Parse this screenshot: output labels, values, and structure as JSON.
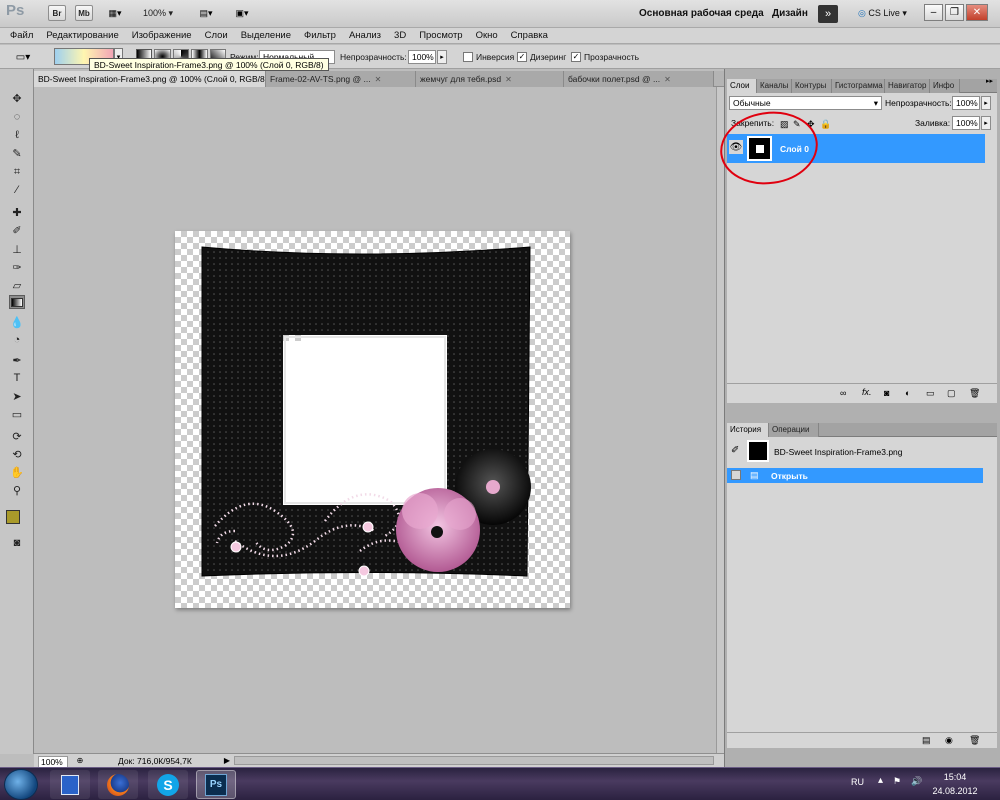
{
  "appbar": {
    "app_logo": "Ps",
    "br_label": "Br",
    "mb_label": "Mb",
    "zoom": "100%",
    "workspace": "Основная рабочая среда",
    "design": "Дизайн",
    "more": "»",
    "cslive": "CS Live",
    "cslive_arrow": "▾"
  },
  "window_controls": {
    "minimize": "–",
    "restore": "❐",
    "close": "✕"
  },
  "menu": [
    "Файл",
    "Редактирование",
    "Изображение",
    "Слои",
    "Выделение",
    "Фильтр",
    "Анализ",
    "3D",
    "Просмотр",
    "Окно",
    "Справка"
  ],
  "options": {
    "mode_label": "Режим:",
    "mode_value": "Нормальный",
    "opacity_label": "Непрозрачность:",
    "opacity_value": "100%",
    "inverse_label": "Инверсия",
    "dither_label": "Дизеринг",
    "transparency_label": "Прозрачность",
    "check_mark": "✓"
  },
  "tooltip": "BD-Sweet Inspiration-Frame3.png @ 100% (Слой 0, RGB/8)",
  "doc_tabs": [
    {
      "label": "BD-Sweet Inspiration-Frame3.png @ 100% (Слой 0, RGB/8)",
      "close": "✕"
    },
    {
      "label": "Frame-02-AV-TS.png @ ...",
      "close": "✕"
    },
    {
      "label": "жемчуг для тебя.psd",
      "close": "✕"
    },
    {
      "label": "бабочки полет.psd @ ...",
      "close": "✕"
    }
  ],
  "status": {
    "zoom": "100%",
    "doc": "Док: 716,0К/954,7К"
  },
  "layers_panel": {
    "tabs": [
      "Слои",
      "Каналы",
      "Контуры",
      "Гистограмма",
      "Навигатор",
      "Инфо"
    ],
    "blend_mode": "Обычные",
    "opacity_label": "Непрозрачность:",
    "opacity_value": "100%",
    "lock_label": "Закрепить:",
    "fill_label": "Заливка:",
    "fill_value": "100%",
    "layer_name": "Слой 0",
    "footer_icons": [
      "link-icon",
      "fx-icon",
      "mask-icon",
      "adjustment-icon",
      "group-icon",
      "new-layer-icon",
      "trash-icon"
    ],
    "fx_label": "fx."
  },
  "history_panel": {
    "tabs": [
      "История",
      "Операции"
    ],
    "snapshot": "BD-Sweet Inspiration-Frame3.png",
    "step": "Открыть"
  },
  "taskbar": {
    "lang": "RU",
    "time": "15:04",
    "date": "24.08.2012",
    "apps": [
      "Windows Explorer",
      "Firefox",
      "Skype",
      "Photoshop"
    ],
    "skype_label": "S",
    "ps_label": "Ps"
  },
  "colors": {
    "accent": "#3399ff",
    "frame": "#111111",
    "flower_pink": "#d98bbf",
    "annotation": "#e0000f"
  }
}
